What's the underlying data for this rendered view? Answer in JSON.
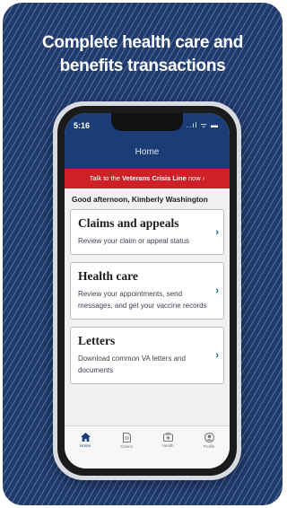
{
  "headline": {
    "line1": "Complete health care and",
    "line2": "benefits transactions"
  },
  "status_bar": {
    "time": "5:16",
    "icons": "..ıl ᯤ ▬"
  },
  "nav": {
    "title": "Home"
  },
  "crisis_banner": {
    "prefix": "Talk to the ",
    "link": "Veterans Crisis Line",
    "suffix": " now",
    "arrow": "›"
  },
  "greeting": "Good afternoon, Kimberly Washington",
  "tiles": [
    {
      "title": "Claims and appeals",
      "description": "Review your claim or appeal status"
    },
    {
      "title": "Health care",
      "description": "Review your appointments, send messages, and get your vaccine records"
    },
    {
      "title": "Letters",
      "description": "Download common VA letters and documents"
    }
  ],
  "tabs": [
    {
      "label": "Home",
      "icon": "home-icon"
    },
    {
      "label": "Claims",
      "icon": "claims-icon"
    },
    {
      "label": "Health",
      "icon": "health-icon"
    },
    {
      "label": "Profile",
      "icon": "profile-icon"
    }
  ],
  "colors": {
    "background": "#1f3a6e",
    "app_bar": "#1a3d78",
    "crisis_banner": "#cf2027",
    "link": "#005ea2"
  }
}
